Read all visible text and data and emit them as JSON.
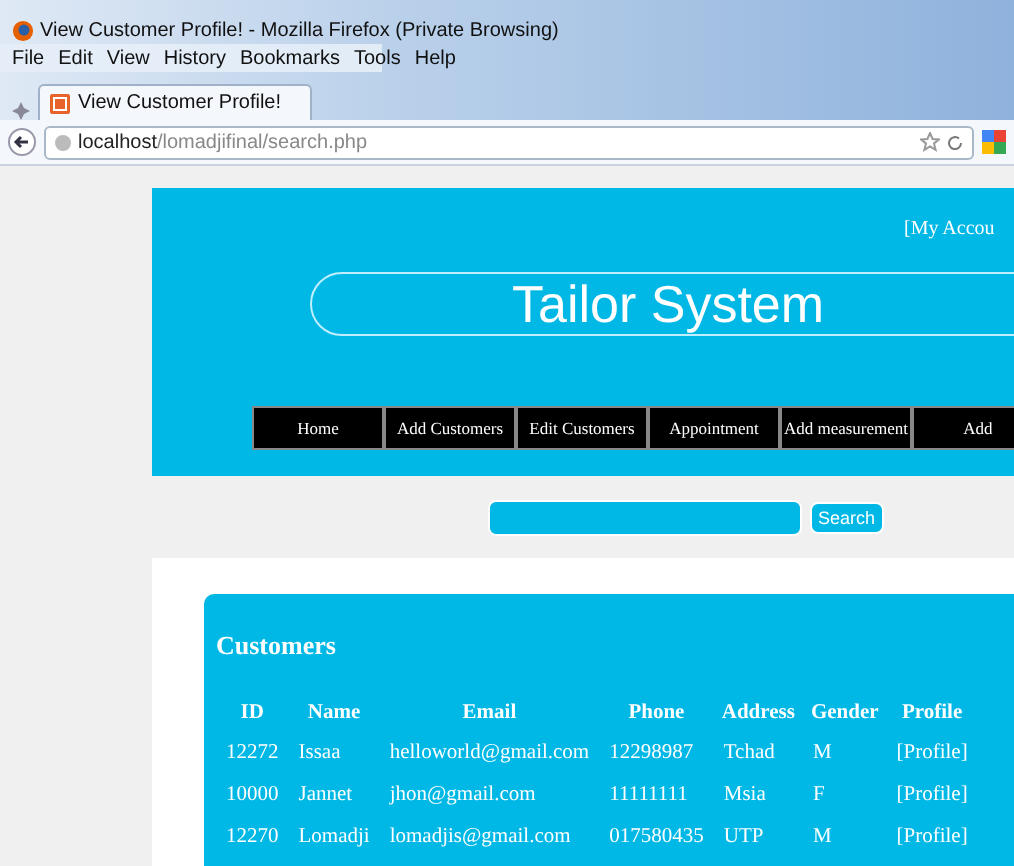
{
  "window": {
    "title": "View Customer Profile! - Mozilla Firefox (Private Browsing)"
  },
  "menu": [
    "File",
    "Edit",
    "View",
    "History",
    "Bookmarks",
    "Tools",
    "Help"
  ],
  "tabs": [
    {
      "label": "View Customer Profile!",
      "selected": true
    }
  ],
  "address": {
    "host": "localhost",
    "path": "/lomadjifinal/search.php"
  },
  "header": {
    "account_link": "[My Accou",
    "title": "Tailor System"
  },
  "nav": [
    "Home",
    "Add Customers",
    "Edit Customers",
    "Appointment",
    "Add measurement",
    "Add"
  ],
  "search": {
    "button": "Search"
  },
  "customers": {
    "heading": "Customers",
    "columns": [
      "ID",
      "Name",
      "Email",
      "Phone",
      "Address",
      "Gender",
      "Profile"
    ],
    "rows": [
      [
        "12272",
        "Issaa",
        "helloworld@gmail.com",
        "12298987",
        "Tchad",
        "M",
        "[Profile]"
      ],
      [
        "10000",
        "Jannet",
        "jhon@gmail.com",
        "11111111",
        "Msia",
        "F",
        "[Profile]"
      ],
      [
        "12270",
        "Lomadji",
        "lomadjis@gmail.com",
        "017580435",
        "UTP",
        "M",
        "[Profile]"
      ]
    ]
  }
}
